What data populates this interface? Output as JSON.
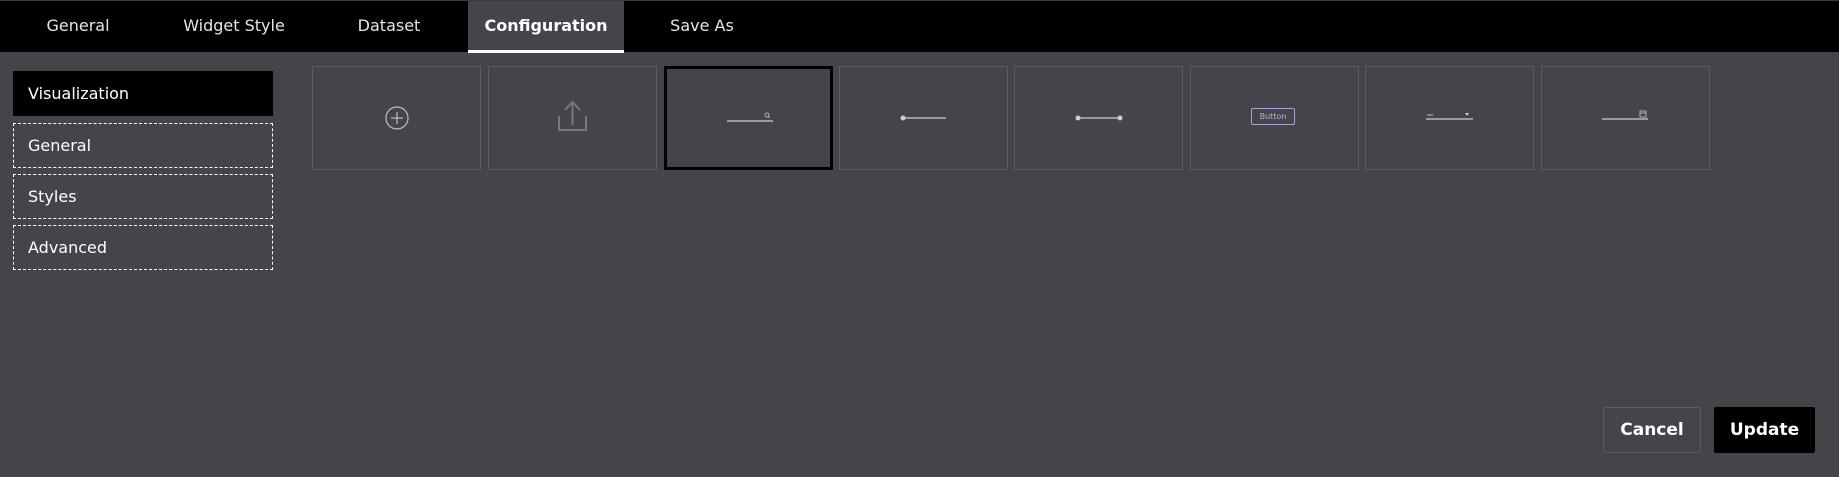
{
  "tabs": [
    {
      "label": "General"
    },
    {
      "label": "Widget Style"
    },
    {
      "label": "Dataset"
    },
    {
      "label": "Configuration",
      "active": true
    },
    {
      "label": "Save As"
    }
  ],
  "sidebar": {
    "items": [
      {
        "label": "Visualization",
        "active": true
      },
      {
        "label": "General"
      },
      {
        "label": "Styles"
      },
      {
        "label": "Advanced"
      }
    ]
  },
  "tiles": [
    {
      "icon": "add-circle-icon"
    },
    {
      "icon": "upload-icon"
    },
    {
      "icon": "slider-search-icon",
      "selected": true
    },
    {
      "icon": "single-slider-icon"
    },
    {
      "icon": "range-slider-icon"
    },
    {
      "icon": "button-icon",
      "label": "Button"
    },
    {
      "icon": "slider-dropdown-icon"
    },
    {
      "icon": "slider-calendar-icon"
    }
  ],
  "actions": {
    "cancel_label": "Cancel",
    "update_label": "Update"
  },
  "colors": {
    "background": "#47434a",
    "topbar": "#000000",
    "accent": "#000000"
  }
}
